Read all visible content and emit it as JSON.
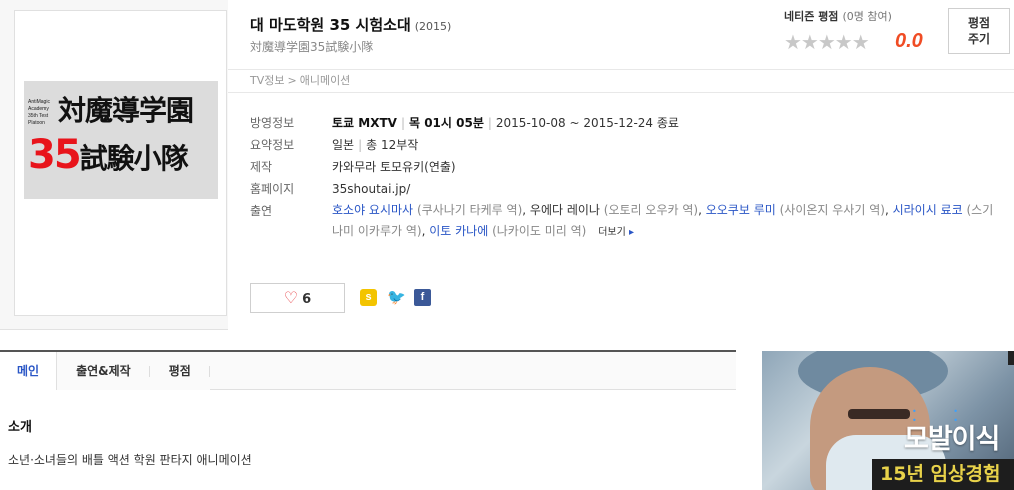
{
  "show": {
    "title": "대 마도학원 35 시험소대",
    "year": "(2015)",
    "original_title": "対魔導学園35試験小隊"
  },
  "poster": {
    "small_text": "AntiMagic Academy 35th Test Platoon",
    "line1": "対魔導学園",
    "line2_num": "35",
    "line2_kanji": "試験小隊"
  },
  "rating": {
    "label": "네티즌 평점",
    "count": "(0명 참여)",
    "stars": "★★★★★",
    "score": "0.0",
    "button_label_1": "평점",
    "button_label_2": "주기"
  },
  "breadcrumb": {
    "items": [
      "TV정보",
      "애니메이션"
    ],
    "separator": ">"
  },
  "details": {
    "broadcast_label": "방영정보",
    "broadcast_channel": "토쿄 MXTV",
    "broadcast_time": "목 01시 05분",
    "broadcast_period": "2015-10-08 ~ 2015-12-24 종료",
    "summary_label": "요약정보",
    "summary_country": "일본",
    "summary_episodes": "총 12부작",
    "production_label": "제작",
    "production_value": "카와무라 토모유키(연출)",
    "homepage_label": "홈페이지",
    "homepage_value": "35shoutai.jp/",
    "cast_label": "출연",
    "cast": [
      {
        "actor": "호소야 요시마사",
        "role": "(쿠사나기 타케루 역)"
      },
      {
        "actor": "우에다 레이나",
        "role": "(오토리 오우카 역)"
      },
      {
        "actor": "오오쿠보 루미",
        "role": "(사이온지 우사기 역)"
      },
      {
        "actor": "시라이시 료코",
        "role": "(스기나미 이카루가 역)"
      },
      {
        "actor": "이토 카나에",
        "role": "(나카이도 미리 역)"
      }
    ],
    "more_label": "더보기",
    "more_arrow": "▸"
  },
  "actions": {
    "like_icon": "♡",
    "like_count": "6",
    "share_kakao": "s",
    "share_twitter": "🐦",
    "share_facebook": "f"
  },
  "tabs": [
    {
      "label": "메인"
    },
    {
      "label": "출연&제작"
    },
    {
      "label": "평점"
    }
  ],
  "intro": {
    "title": "소개",
    "text": "소년·소녀들의 배틀 액션 학원 판타지 애니메이션"
  },
  "ad": {
    "dots": "• • • •",
    "headline": "모발이식",
    "subline": "15년 임상경험"
  },
  "colors": {
    "accent_blue": "#2a56c6",
    "score_orange": "#f04c24",
    "poster_red": "#e8141b"
  }
}
